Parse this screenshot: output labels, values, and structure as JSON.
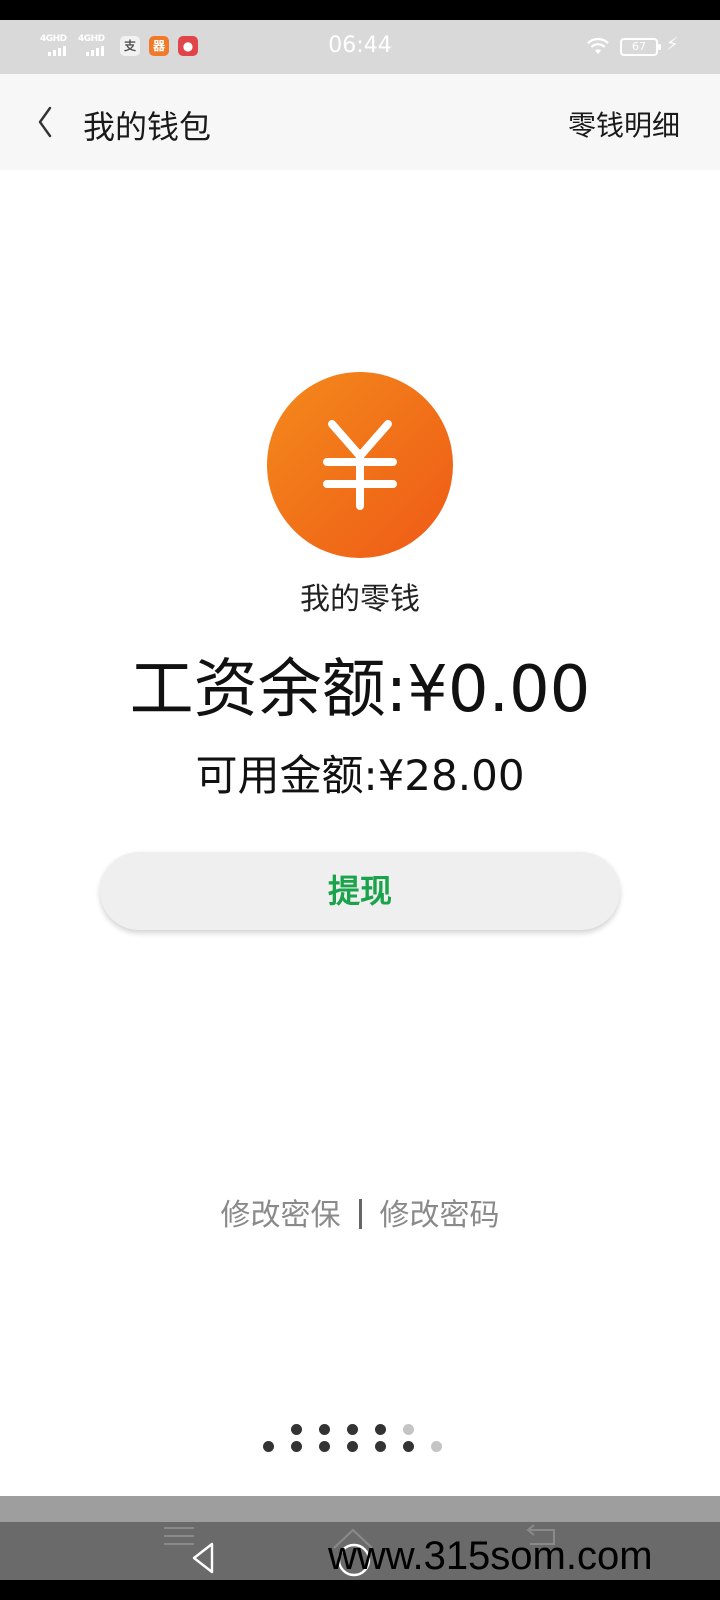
{
  "status_bar": {
    "time": "06:44",
    "signal_1": "4GHD",
    "signal_2": "4GHD",
    "battery": "67",
    "app_icon_1": "支",
    "app_icon_2": "器",
    "app_icon_3": "●"
  },
  "nav": {
    "title": "我的钱包",
    "right_action": "零钱明细"
  },
  "wallet": {
    "label": "我的零钱",
    "salary_balance": "工资余额:¥0.00",
    "available_amount": "可用金额:¥28.00",
    "withdraw_button": "提现"
  },
  "links": {
    "change_security": "修改密保",
    "change_password": "修改密码"
  },
  "watermark": "www.315som.com",
  "colors": {
    "accent_green": "#1aa34a",
    "coin_orange": "#ee5a16",
    "nav_bg": "#f7f7f7"
  }
}
